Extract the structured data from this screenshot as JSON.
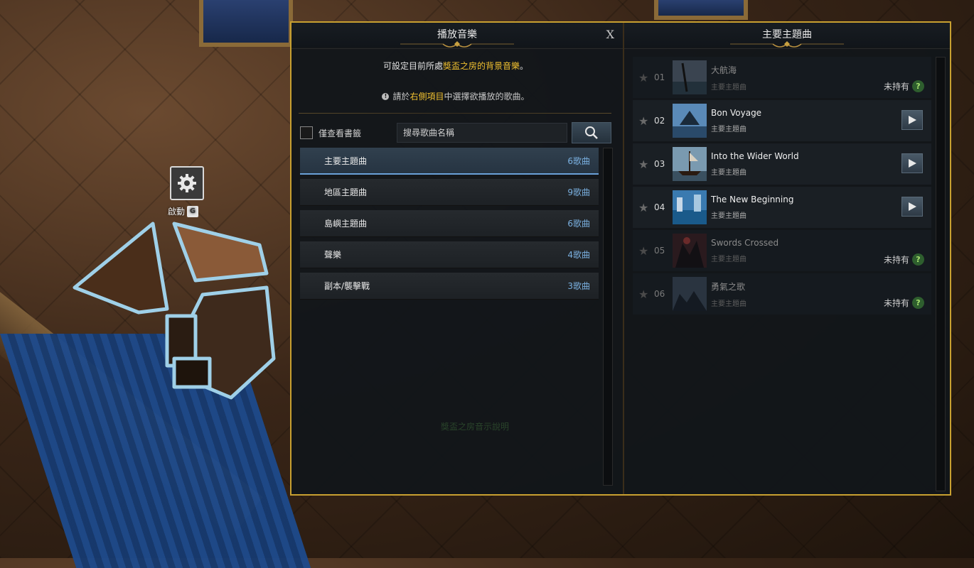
{
  "activate": {
    "label": "啟動",
    "key": "G"
  },
  "left_panel": {
    "title": "播放音樂",
    "close_label": "X",
    "desc_line1_pre": "可設定目前所處",
    "desc_line1_hl": "獎盃之房的背景音樂",
    "desc_line1_post": "。",
    "desc_line2_pre": "請於",
    "desc_line2_hl": "右側項目",
    "desc_line2_post": "中選擇欲播放的歌曲。",
    "info_icon": "!",
    "bookmark_label": "僅查看書籤",
    "search_placeholder": "搜尋歌曲名稱",
    "watermark": "獎盃之房音示說明",
    "categories": [
      {
        "label": "主要主題曲",
        "count": "6歌曲"
      },
      {
        "label": "地區主題曲",
        "count": "9歌曲"
      },
      {
        "label": "島嶼主題曲",
        "count": "6歌曲"
      },
      {
        "label": "聲樂",
        "count": "4歌曲"
      },
      {
        "label": "副本/襲擊戰",
        "count": "3歌曲"
      }
    ]
  },
  "right_panel": {
    "title": "主要主題曲",
    "not_owned_label": "未持有",
    "q_label": "?",
    "tracks": [
      {
        "num": "01",
        "title": "大航海",
        "category": "主要主題曲"
      },
      {
        "num": "02",
        "title": "Bon Voyage",
        "category": "主要主題曲"
      },
      {
        "num": "03",
        "title": "Into the Wider World",
        "category": "主要主題曲"
      },
      {
        "num": "04",
        "title": "The New Beginning",
        "category": "主要主題曲"
      },
      {
        "num": "05",
        "title": "Swords Crossed",
        "category": "主要主題曲"
      },
      {
        "num": "06",
        "title": "勇氣之歌",
        "category": "主要主題曲"
      }
    ]
  },
  "colors": {
    "frame": "#c8a030",
    "highlight": "#f0c030",
    "count": "#7ab0e0",
    "active_underline": "#6aa0d8"
  }
}
